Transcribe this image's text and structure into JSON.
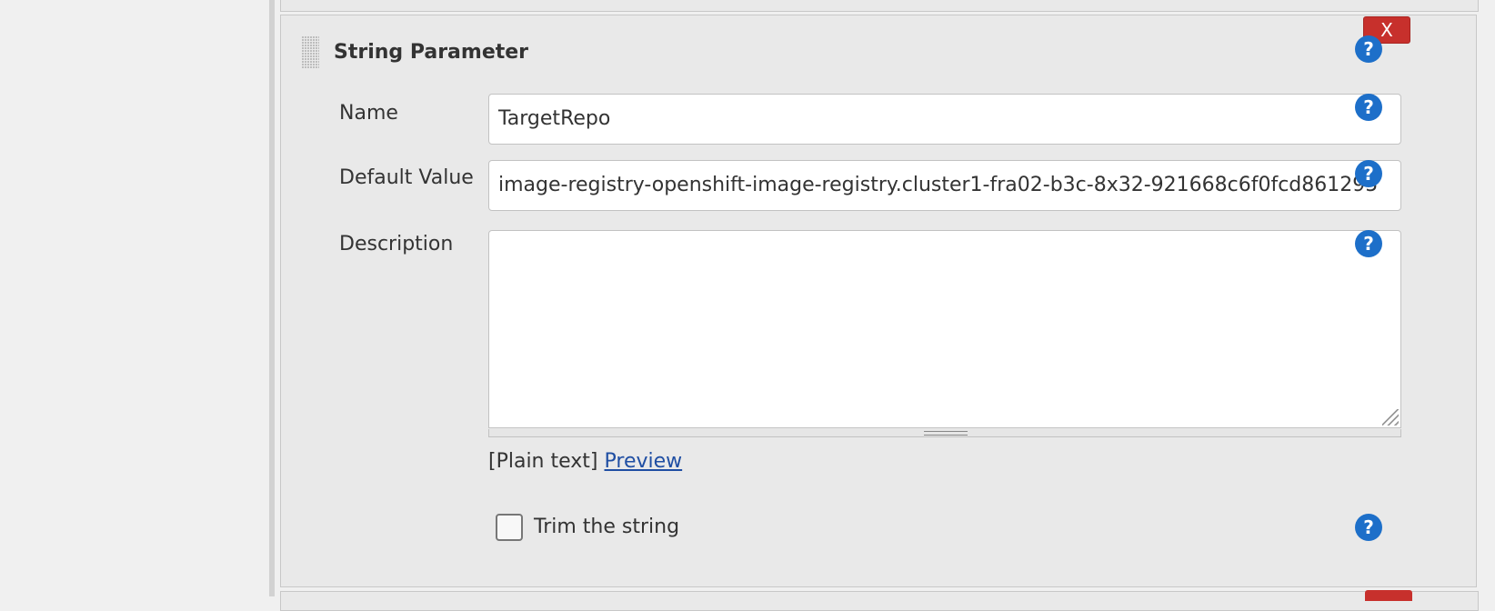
{
  "panel": {
    "title": "String Parameter",
    "delete_label": "X",
    "help_glyph": "?",
    "accent_delete": "#c7302c",
    "accent_help": "#1d6fc9"
  },
  "fields": {
    "name": {
      "label": "Name",
      "value": "TargetRepo"
    },
    "default_value": {
      "label": "Default Value",
      "value": "image-registry-openshift-image-registry.cluster1-fra02-b3c-8x32-921668c6f0fcd861295"
    },
    "description": {
      "label": "Description",
      "value": ""
    }
  },
  "preview": {
    "plain_text": "[Plain text]",
    "link": "Preview"
  },
  "trim": {
    "label": "Trim the string",
    "checked": false
  },
  "icons": {
    "help": "help-icon",
    "drag": "drag-handle-icon",
    "resize": "resize-grip-icon"
  }
}
